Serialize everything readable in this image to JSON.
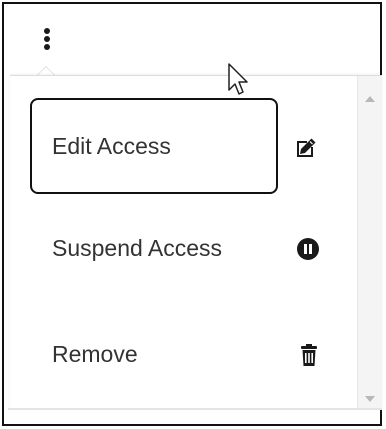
{
  "menu": {
    "items": [
      {
        "label": "Edit Access",
        "icon": "edit-icon",
        "focused": true
      },
      {
        "label": "Suspend Access",
        "icon": "pause-circle-icon",
        "focused": false
      },
      {
        "label": "Remove",
        "icon": "trash-icon",
        "focused": false
      }
    ]
  },
  "colors": {
    "text": "#333333",
    "focus_border": "#111111",
    "icon": "#1a1a1a",
    "scrollbar_track": "#f4f4f4",
    "scroll_arrow": "#b8b8b8"
  },
  "icons": {
    "trigger": "kebab-menu-icon",
    "pointer": "mouse-cursor"
  }
}
